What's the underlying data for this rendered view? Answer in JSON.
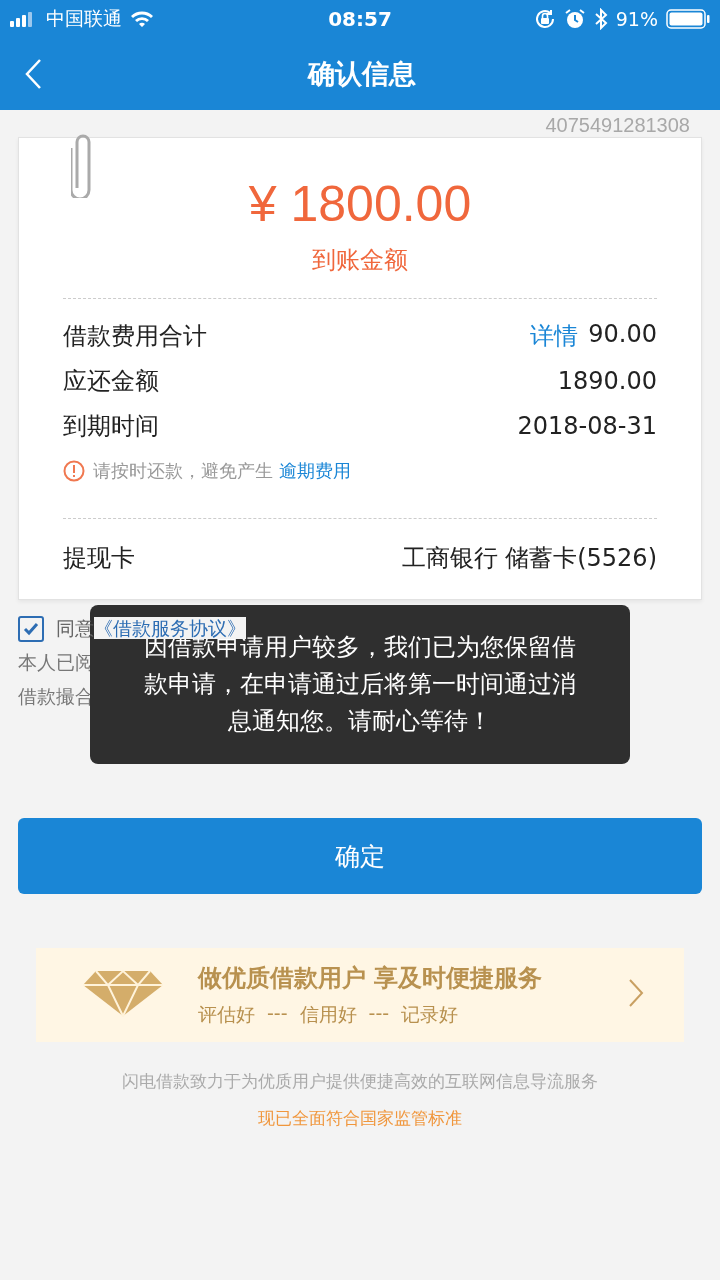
{
  "status_bar": {
    "carrier": "中国联通",
    "time": "08:57",
    "battery": "91%"
  },
  "nav": {
    "title": "确认信息"
  },
  "serial": "4075491281308",
  "amount": {
    "value": "¥ 1800.00",
    "label": "到账金额"
  },
  "rows": [
    {
      "label": "借款费用合计",
      "link": "详情",
      "value": "90.00"
    },
    {
      "label": "应还金额",
      "value": "1890.00"
    },
    {
      "label": "到期时间",
      "value": "2018-08-31"
    }
  ],
  "notice": {
    "text": "请按时还款，避免产生",
    "link": "逾期费用"
  },
  "card_row": {
    "label": "提现卡",
    "value": "工商银行 储蓄卡(5526)"
  },
  "agreement": {
    "checked": true,
    "label": "同意",
    "link": "《借款服务协议》",
    "lines": [
      "本人已阅",
      "借款撮合"
    ]
  },
  "toast": "因借款申请用户较多，我们已为您保留借款申请，在申请通过后将第一时间通过消息通知您。请耐心等待！",
  "confirm_button": "确定",
  "banner": {
    "title": "做优质借款用户 享及时便捷服务",
    "tags": [
      "评估好",
      "信用好",
      "记录好"
    ],
    "separator": "---"
  },
  "footer": {
    "text": "闪电借款致力于为优质用户提供便捷高效的互联网信息导流服务",
    "highlight": "现已全面符合国家监管标准"
  }
}
